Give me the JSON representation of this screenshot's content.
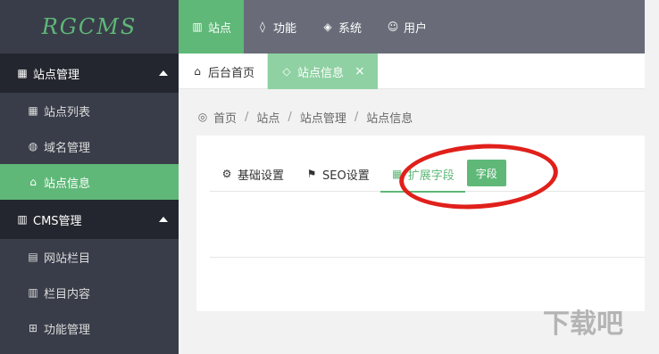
{
  "app": {
    "logo": "RGCMS"
  },
  "topnav": [
    {
      "label": "站点",
      "icon": "book-icon"
    },
    {
      "label": "功能",
      "icon": "drop-icon"
    },
    {
      "label": "系统",
      "icon": "layers-icon"
    },
    {
      "label": "用户",
      "icon": "user-icon"
    }
  ],
  "sidebar": {
    "groups": [
      {
        "label": "站点管理",
        "items": [
          {
            "label": "站点列表"
          },
          {
            "label": "域名管理"
          },
          {
            "label": "站点信息",
            "active": true
          }
        ]
      },
      {
        "label": "CMS管理",
        "items": [
          {
            "label": "网站栏目"
          },
          {
            "label": "栏目内容"
          },
          {
            "label": "功能管理"
          }
        ]
      }
    ]
  },
  "page_tabs": [
    {
      "label": "后台首页"
    },
    {
      "label": "站点信息",
      "active": true,
      "close": "×"
    }
  ],
  "breadcrumb": [
    "首页",
    "站点",
    "站点管理",
    "站点信息"
  ],
  "breadcrumb_sep": "/",
  "sub_tabs": [
    {
      "label": "基础设置"
    },
    {
      "label": "SEO设置"
    },
    {
      "label": "扩展字段",
      "active": true
    }
  ],
  "field_button": "字段",
  "watermark": "下载吧",
  "colors": {
    "accent": "#5fb878",
    "sidebar": "#393d49",
    "sidebar_group": "#23262e",
    "topnav": "#696c78",
    "highlight_ring": "#e0201b"
  }
}
